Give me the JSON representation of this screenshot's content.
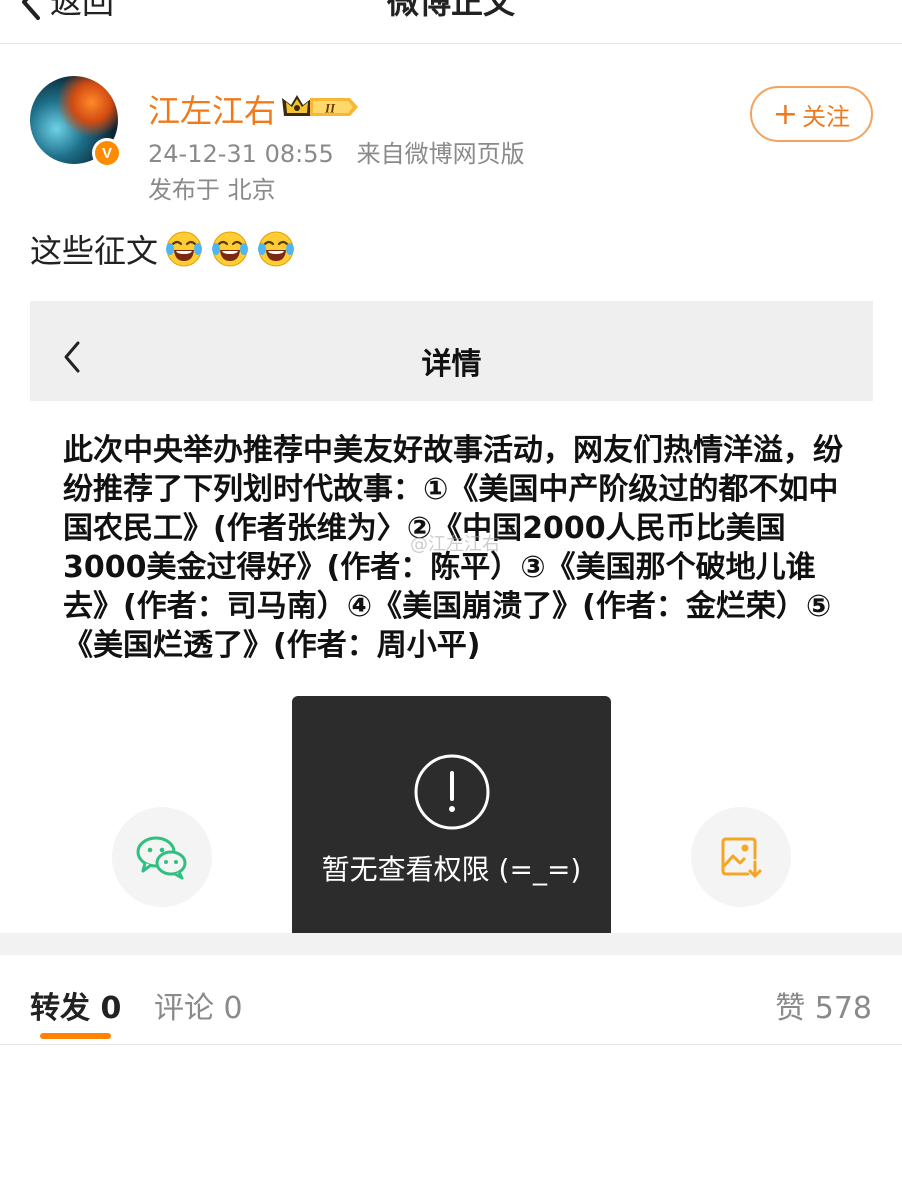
{
  "nav": {
    "back_label": "返回",
    "title": "微博正文"
  },
  "author": {
    "name": "江左江右",
    "verified_mark": "V",
    "vip_level": "II",
    "timestamp": "24-12-31 08:55",
    "source": "来自微博网页版",
    "location": "发布于 北京",
    "follow_label": "关注",
    "follow_plus": "+"
  },
  "post": {
    "text": "这些征文",
    "emoji": [
      "laugh-cry-icon",
      "laugh-cry-icon",
      "laugh-cry-icon"
    ]
  },
  "screenshot": {
    "title": "详情",
    "body": "此次中央举办推荐中美友好故事活动，网友们热情洋溢，纷纷推荐了下列划时代故事：①《美国中产阶级过的都不如中国农民工》(作者张维为〉②《中国2000人民币比美国3000美金过得好》(作者：陈平）③《美国那个破地儿谁去》(作者：司马南）④《美国崩溃了》(作者：金烂荣）⑤《美国烂透了》(作者：周小平)",
    "watermark": "@江左江右"
  },
  "toast": {
    "text": "暂无查看权限 (=_=)"
  },
  "tabs": {
    "repost": "转发 0",
    "comment": "评论 0",
    "like": "赞 578"
  },
  "colors": {
    "accent_orange": "#f07a1b",
    "tab_underline": "#ff8200",
    "toast_bg": "#2c2c2c",
    "wechat_green": "#2fc07f",
    "save_orange": "#f5a623"
  },
  "icons": {
    "back": "chevron-left-icon",
    "more": "more-dots-icon",
    "wechat": "wechat-icon",
    "save_image": "save-image-icon",
    "alert": "exclamation-circle-icon"
  }
}
